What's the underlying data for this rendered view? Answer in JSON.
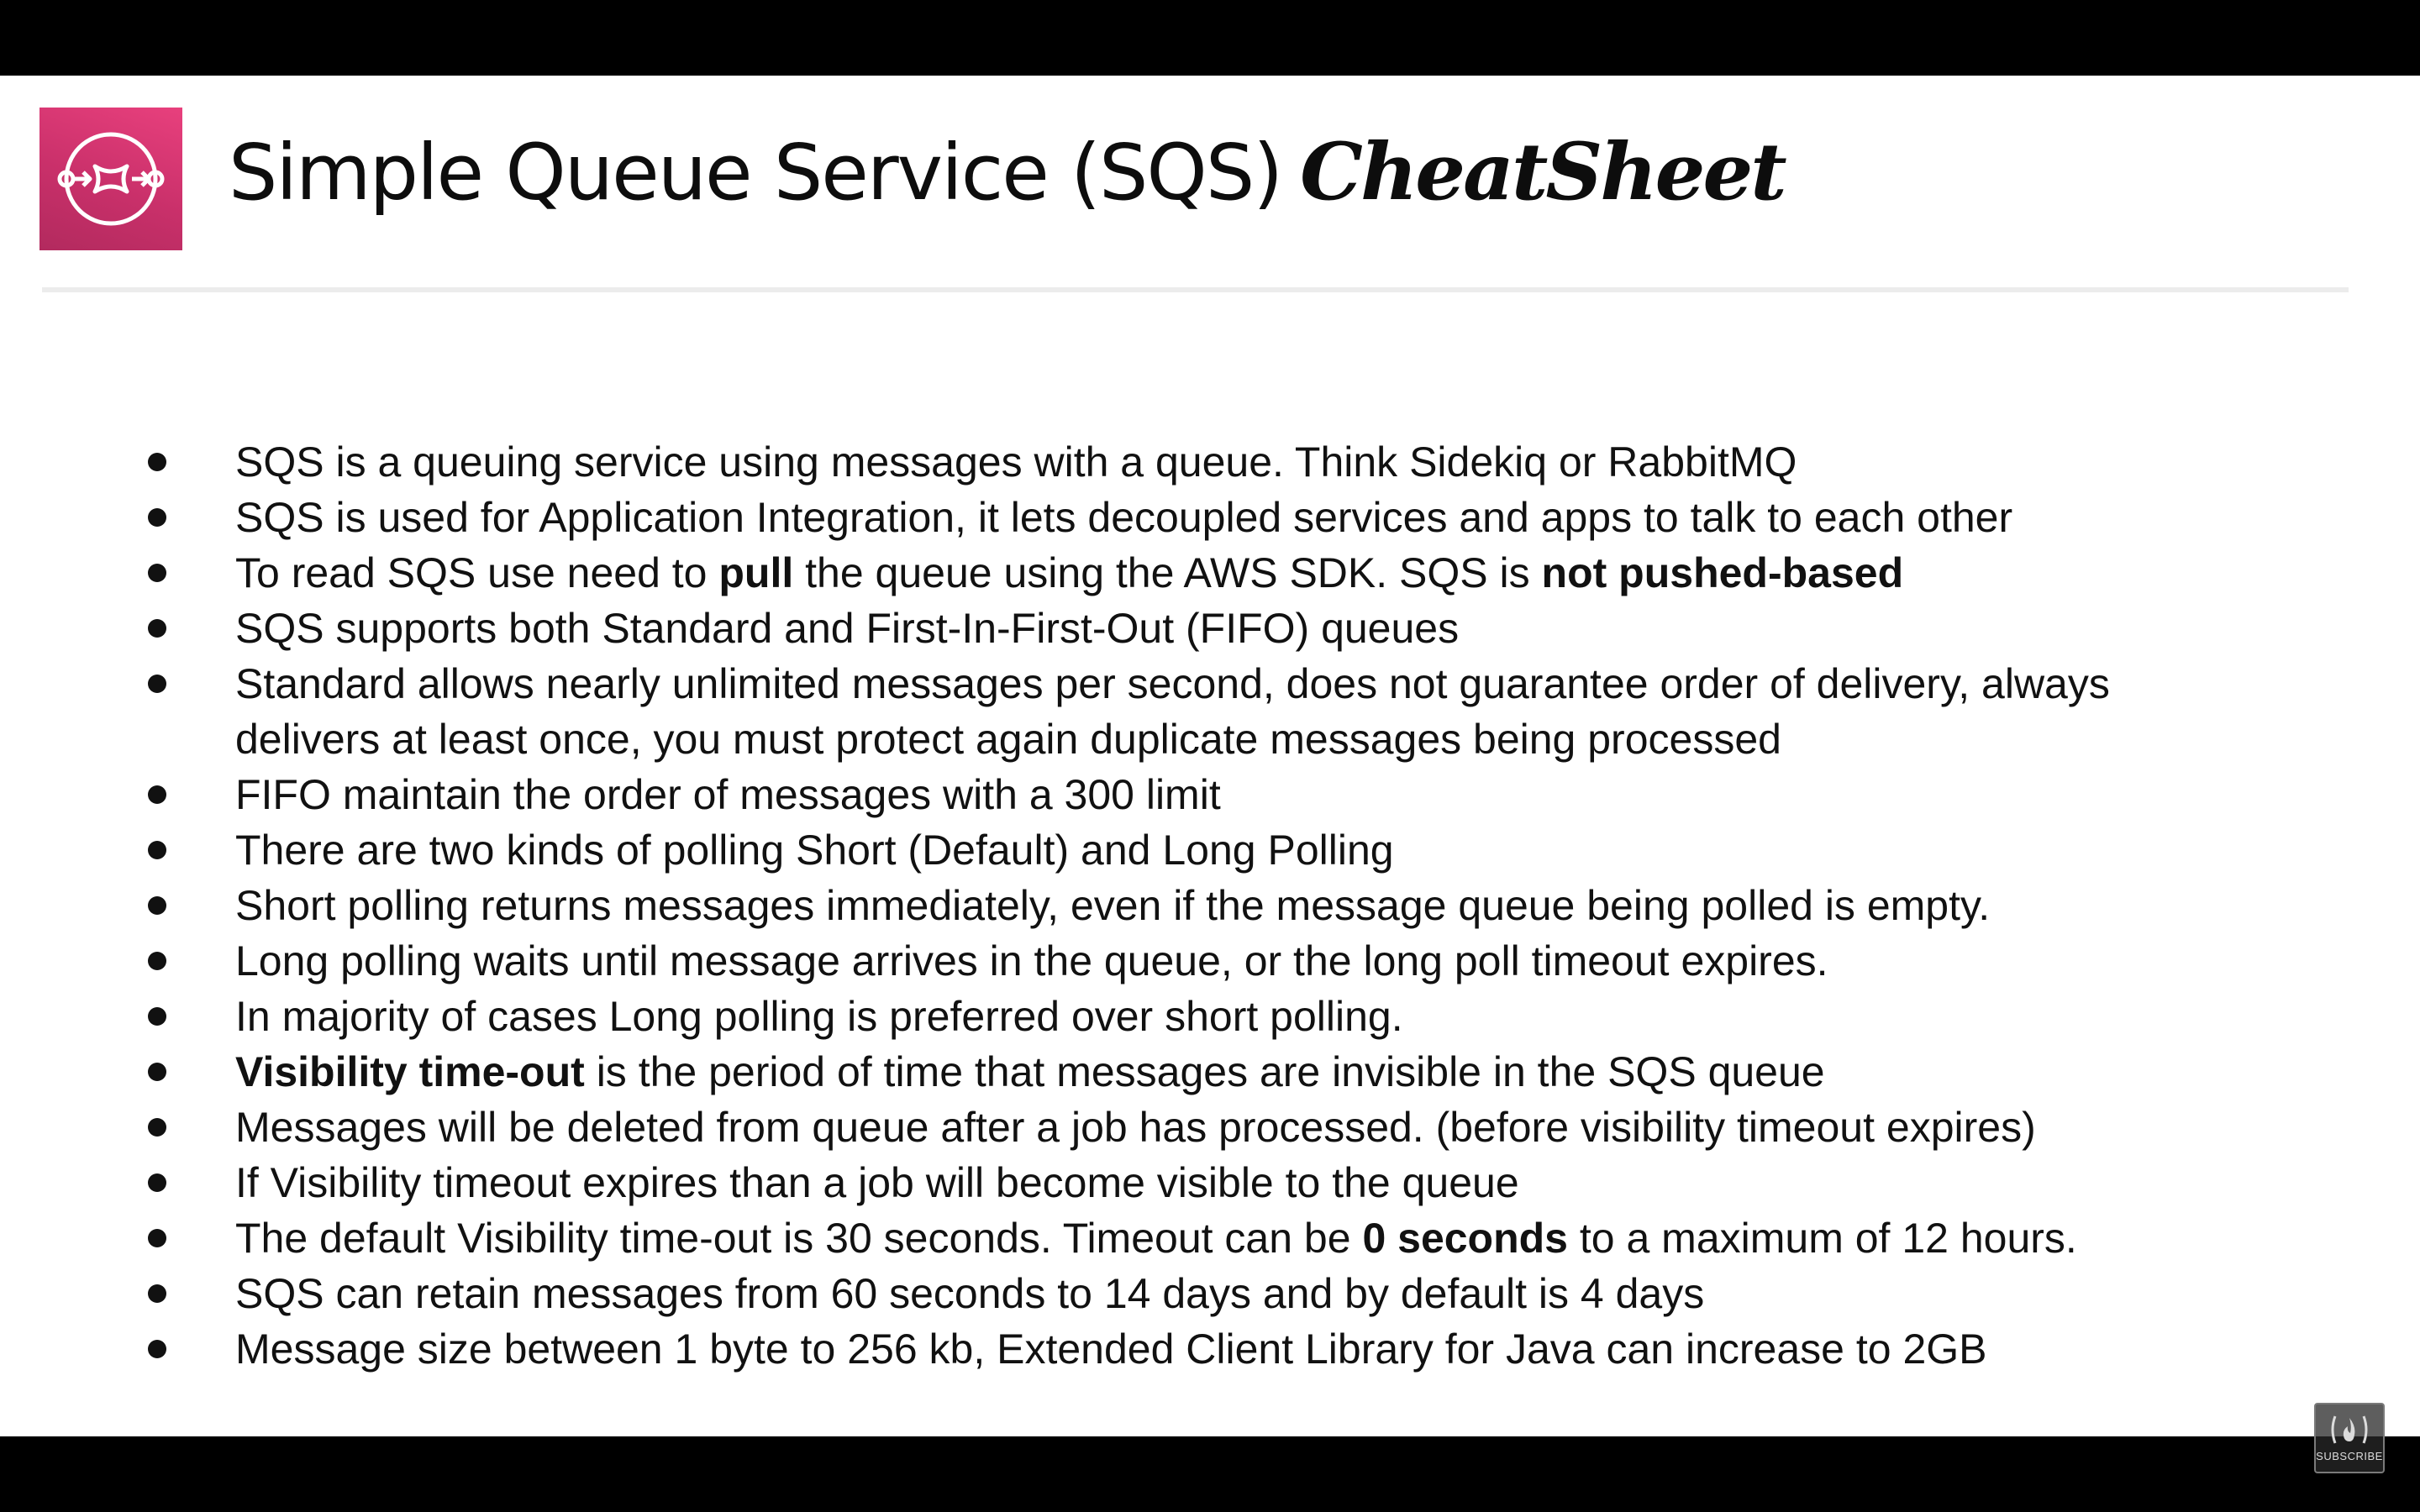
{
  "header": {
    "title_main": "Simple Queue Service (SQS)",
    "title_accent": "CheatSheet",
    "logo_icon": "sqs-queue-icon",
    "logo_color": "#d6336f"
  },
  "bullets": [
    {
      "segments": [
        {
          "text": "SQS is a queuing service using messages with a queue. Think Sidekiq or RabbitMQ",
          "bold": false
        }
      ]
    },
    {
      "segments": [
        {
          "text": "SQS is used for Application Integration, it lets decoupled services and apps to talk to each other",
          "bold": false
        }
      ]
    },
    {
      "segments": [
        {
          "text": "To read SQS use need to ",
          "bold": false
        },
        {
          "text": "pull",
          "bold": true
        },
        {
          "text": " the queue using the AWS SDK. SQS is ",
          "bold": false
        },
        {
          "text": "not pushed-based",
          "bold": true
        }
      ]
    },
    {
      "segments": [
        {
          "text": "SQS supports both Standard and First-In-First-Out (FIFO) queues",
          "bold": false
        }
      ]
    },
    {
      "segments": [
        {
          "text": "Standard allows nearly unlimited messages per second, does not guarantee order of delivery, always delivers at least once, you must protect again duplicate messages being processed",
          "bold": false
        }
      ],
      "wrap": true
    },
    {
      "segments": [
        {
          "text": "FIFO maintain the order of messages with a 300 limit",
          "bold": false
        }
      ]
    },
    {
      "segments": [
        {
          "text": "There are two kinds of polling Short (Default) and Long Polling",
          "bold": false
        }
      ]
    },
    {
      "segments": [
        {
          "text": "Short polling returns messages immediately, even if the message queue being polled is empty.",
          "bold": false
        }
      ]
    },
    {
      "segments": [
        {
          "text": "Long polling waits until message arrives in the queue, or the long poll timeout expires.",
          "bold": false
        }
      ]
    },
    {
      "segments": [
        {
          "text": "In majority of cases Long polling is preferred over short polling.",
          "bold": false
        }
      ]
    },
    {
      "segments": [
        {
          "text": "Visibility time-out",
          "bold": true
        },
        {
          "text": " is the period of time that messages are invisible in the SQS queue",
          "bold": false
        }
      ]
    },
    {
      "segments": [
        {
          "text": "Messages will be deleted from queue after a job has processed. (before visibility timeout expires)",
          "bold": false
        }
      ]
    },
    {
      "segments": [
        {
          "text": "If Visibility timeout expires than a job will become visible to the queue",
          "bold": false
        }
      ]
    },
    {
      "segments": [
        {
          "text": "The default Visibility time-out is 30 seconds. Timeout can be ",
          "bold": false
        },
        {
          "text": "0 seconds",
          "bold": true
        },
        {
          "text": " to a maximum of 12 hours.",
          "bold": false
        }
      ]
    },
    {
      "segments": [
        {
          "text": "SQS can retain messages from 60 seconds to 14 days and by default is 4 days",
          "bold": false
        }
      ]
    },
    {
      "segments": [
        {
          "text": "Message size between 1 byte to 256 kb, Extended Client Library for Java can increase to 2GB",
          "bold": false
        }
      ]
    }
  ],
  "overlay": {
    "subscribe_label": "SUBSCRIBE",
    "subscribe_icon": "flame-icon"
  }
}
